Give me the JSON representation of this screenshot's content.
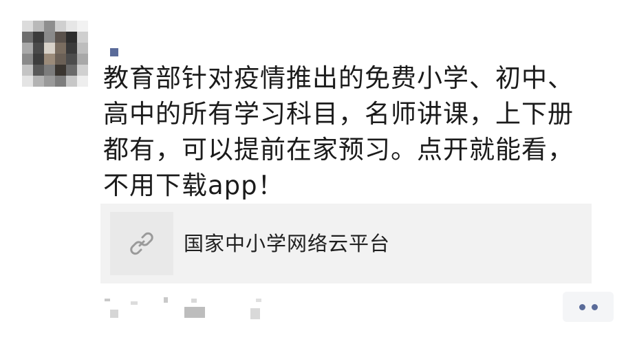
{
  "post": {
    "text": "教育部针对疫情推出的免费小学、初中、\n高中的所有学习科目，名师讲课，上下册\n都有，可以提前在家预习。点开就能看，\n不用下载app！"
  },
  "link_card": {
    "title": "国家中小学网络云平台",
    "icon": "link-icon"
  },
  "more_button": {
    "icon": "more-dots-icon"
  },
  "colors": {
    "text": "#1b1b1b",
    "card_background": "#f2f2f2",
    "accent": "#5a6b99"
  }
}
